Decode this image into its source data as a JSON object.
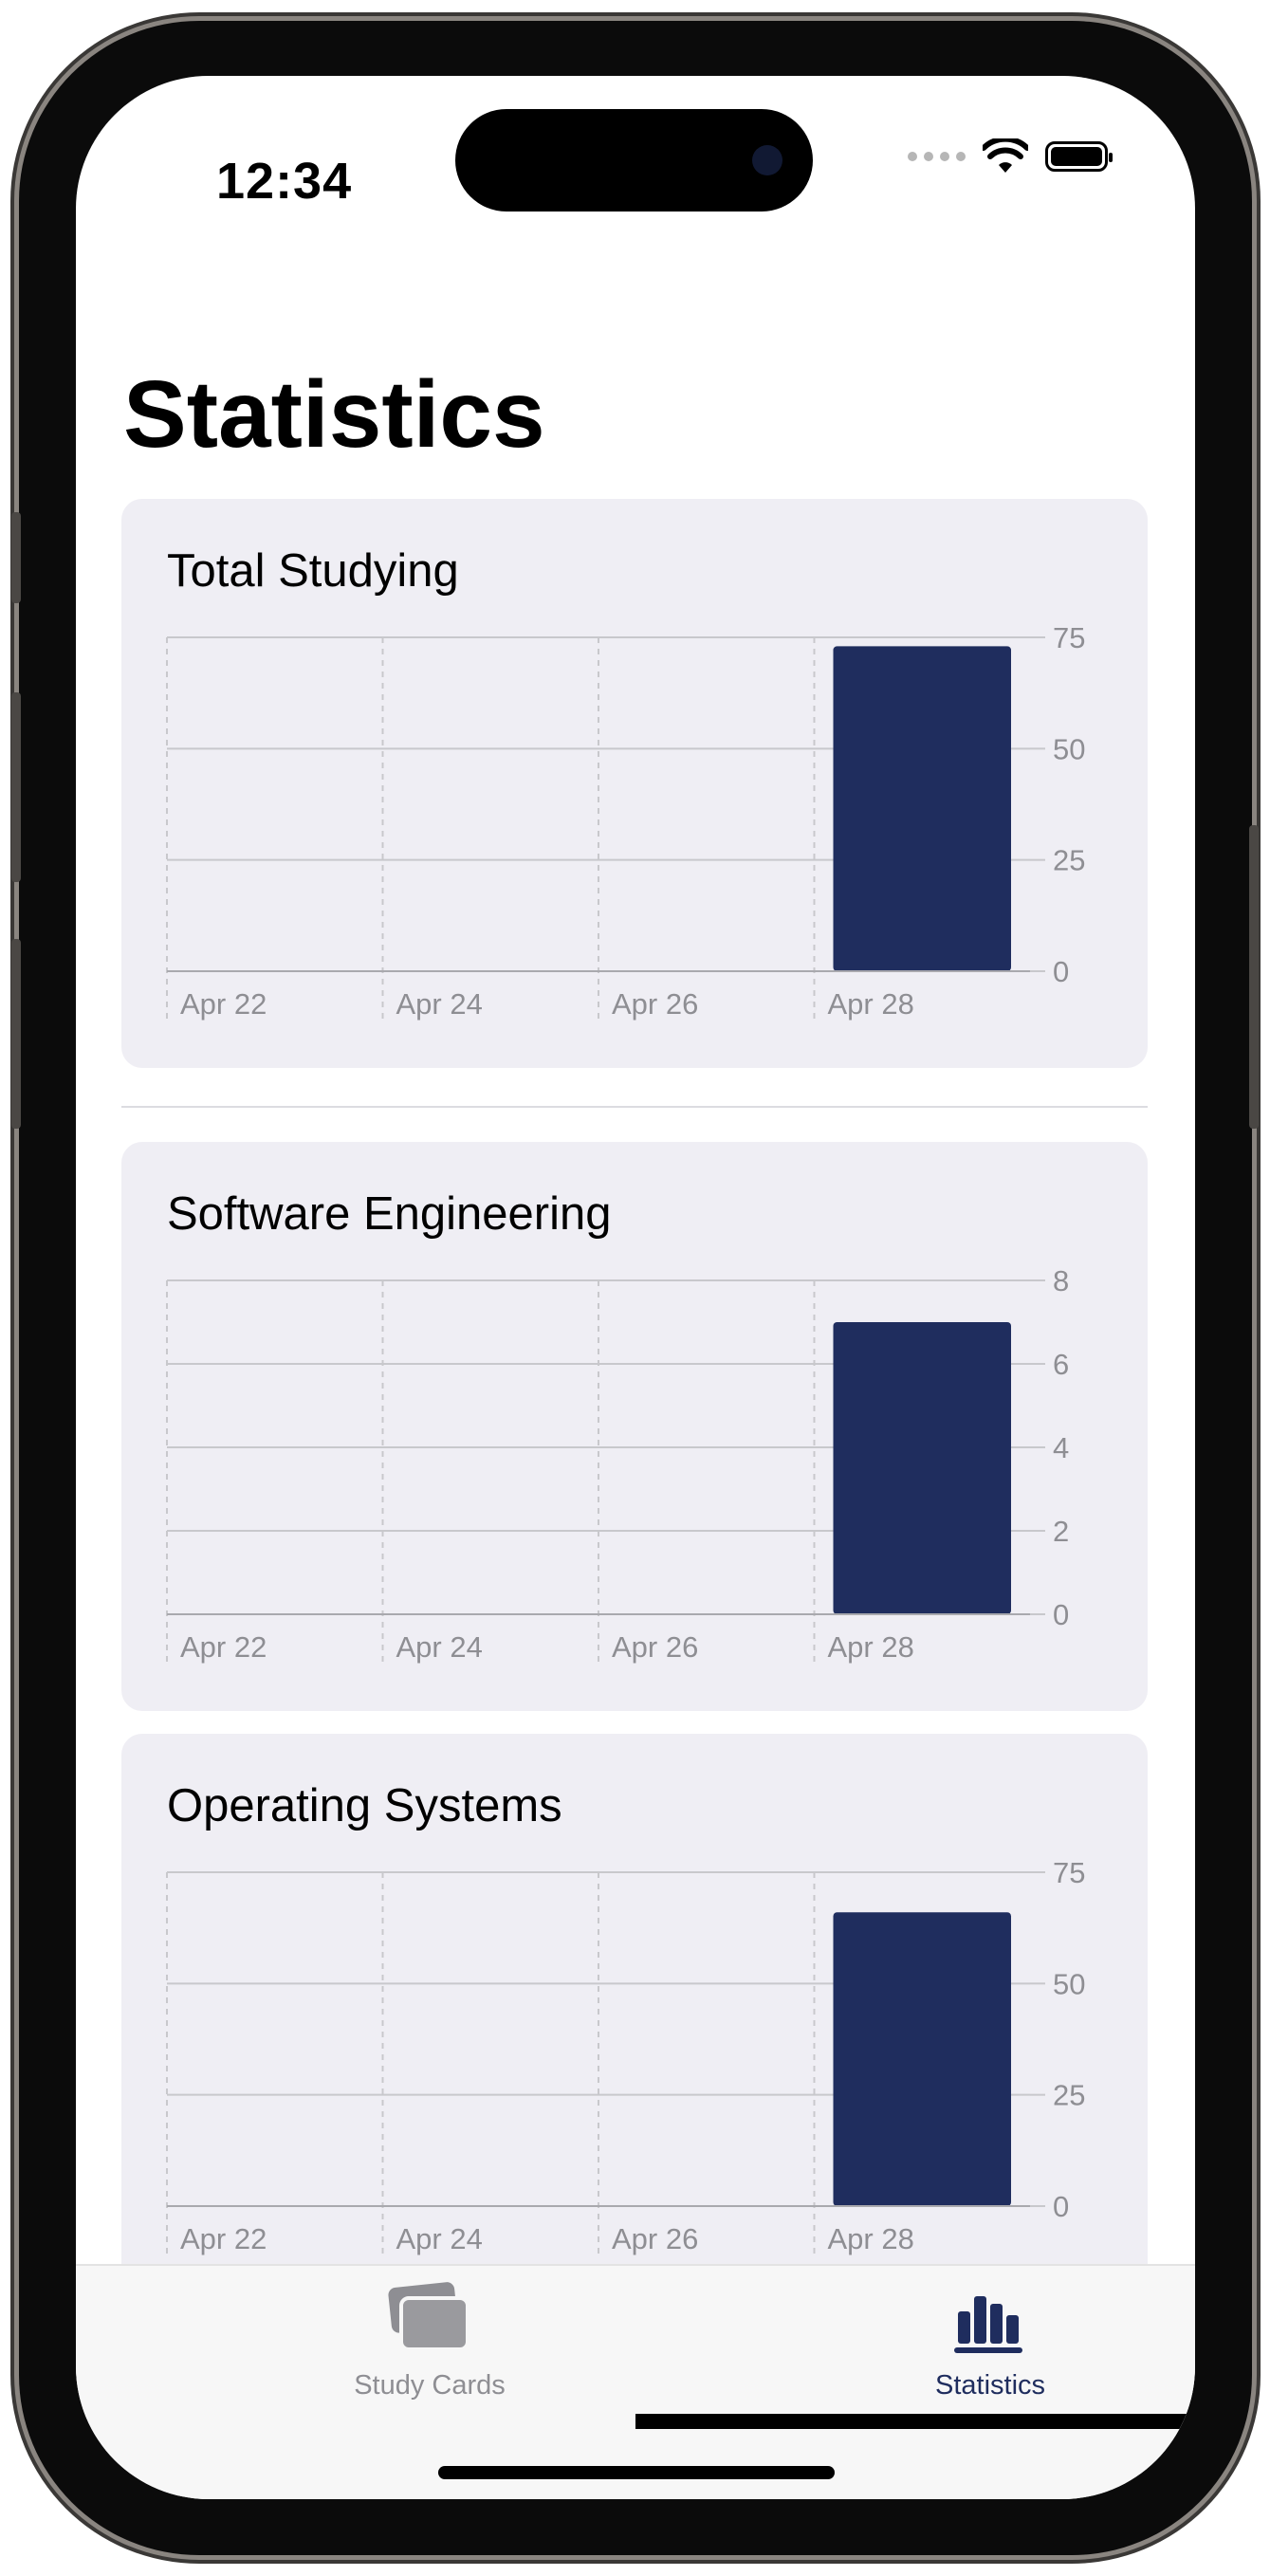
{
  "status_bar": {
    "time": "12:34"
  },
  "page": {
    "title": "Statistics"
  },
  "charts": [
    {
      "title": "Total Studying",
      "chart_data": {
        "type": "bar",
        "title": "Total Studying",
        "categories": [
          "Apr 22",
          "Apr 24",
          "Apr 26",
          "Apr 28"
        ],
        "values": [
          0,
          0,
          0,
          73
        ],
        "yticks": [
          0,
          25,
          50,
          75
        ],
        "ylim": [
          0,
          75
        ],
        "grid": true,
        "bar_color": "#1f2d5e"
      }
    },
    {
      "title": "Software Engineering",
      "chart_data": {
        "type": "bar",
        "title": "Software Engineering",
        "categories": [
          "Apr 22",
          "Apr 24",
          "Apr 26",
          "Apr 28"
        ],
        "values": [
          0,
          0,
          0,
          7
        ],
        "yticks": [
          0,
          2,
          4,
          6,
          8
        ],
        "ylim": [
          0,
          8
        ],
        "grid": true,
        "bar_color": "#1f2d5e"
      }
    },
    {
      "title": "Operating Systems",
      "chart_data": {
        "type": "bar",
        "title": "Operating Systems",
        "categories": [
          "Apr 22",
          "Apr 24",
          "Apr 26",
          "Apr 28"
        ],
        "values": [
          0,
          0,
          0,
          66
        ],
        "yticks": [
          0,
          25,
          50,
          75
        ],
        "ylim": [
          0,
          75
        ],
        "grid": true,
        "bar_color": "#1f2d5e"
      }
    }
  ],
  "tab_bar": {
    "tabs": [
      {
        "label": "Study Cards",
        "icon": "cards-icon",
        "selected": false,
        "color": "#8e8e93"
      },
      {
        "label": "Statistics",
        "icon": "bar-chart-icon",
        "selected": true,
        "color": "#1f2d5e"
      }
    ]
  },
  "colors": {
    "accent": "#1f2d5e",
    "card_bg": "#efeef4",
    "axis_text": "#8e8e93"
  }
}
